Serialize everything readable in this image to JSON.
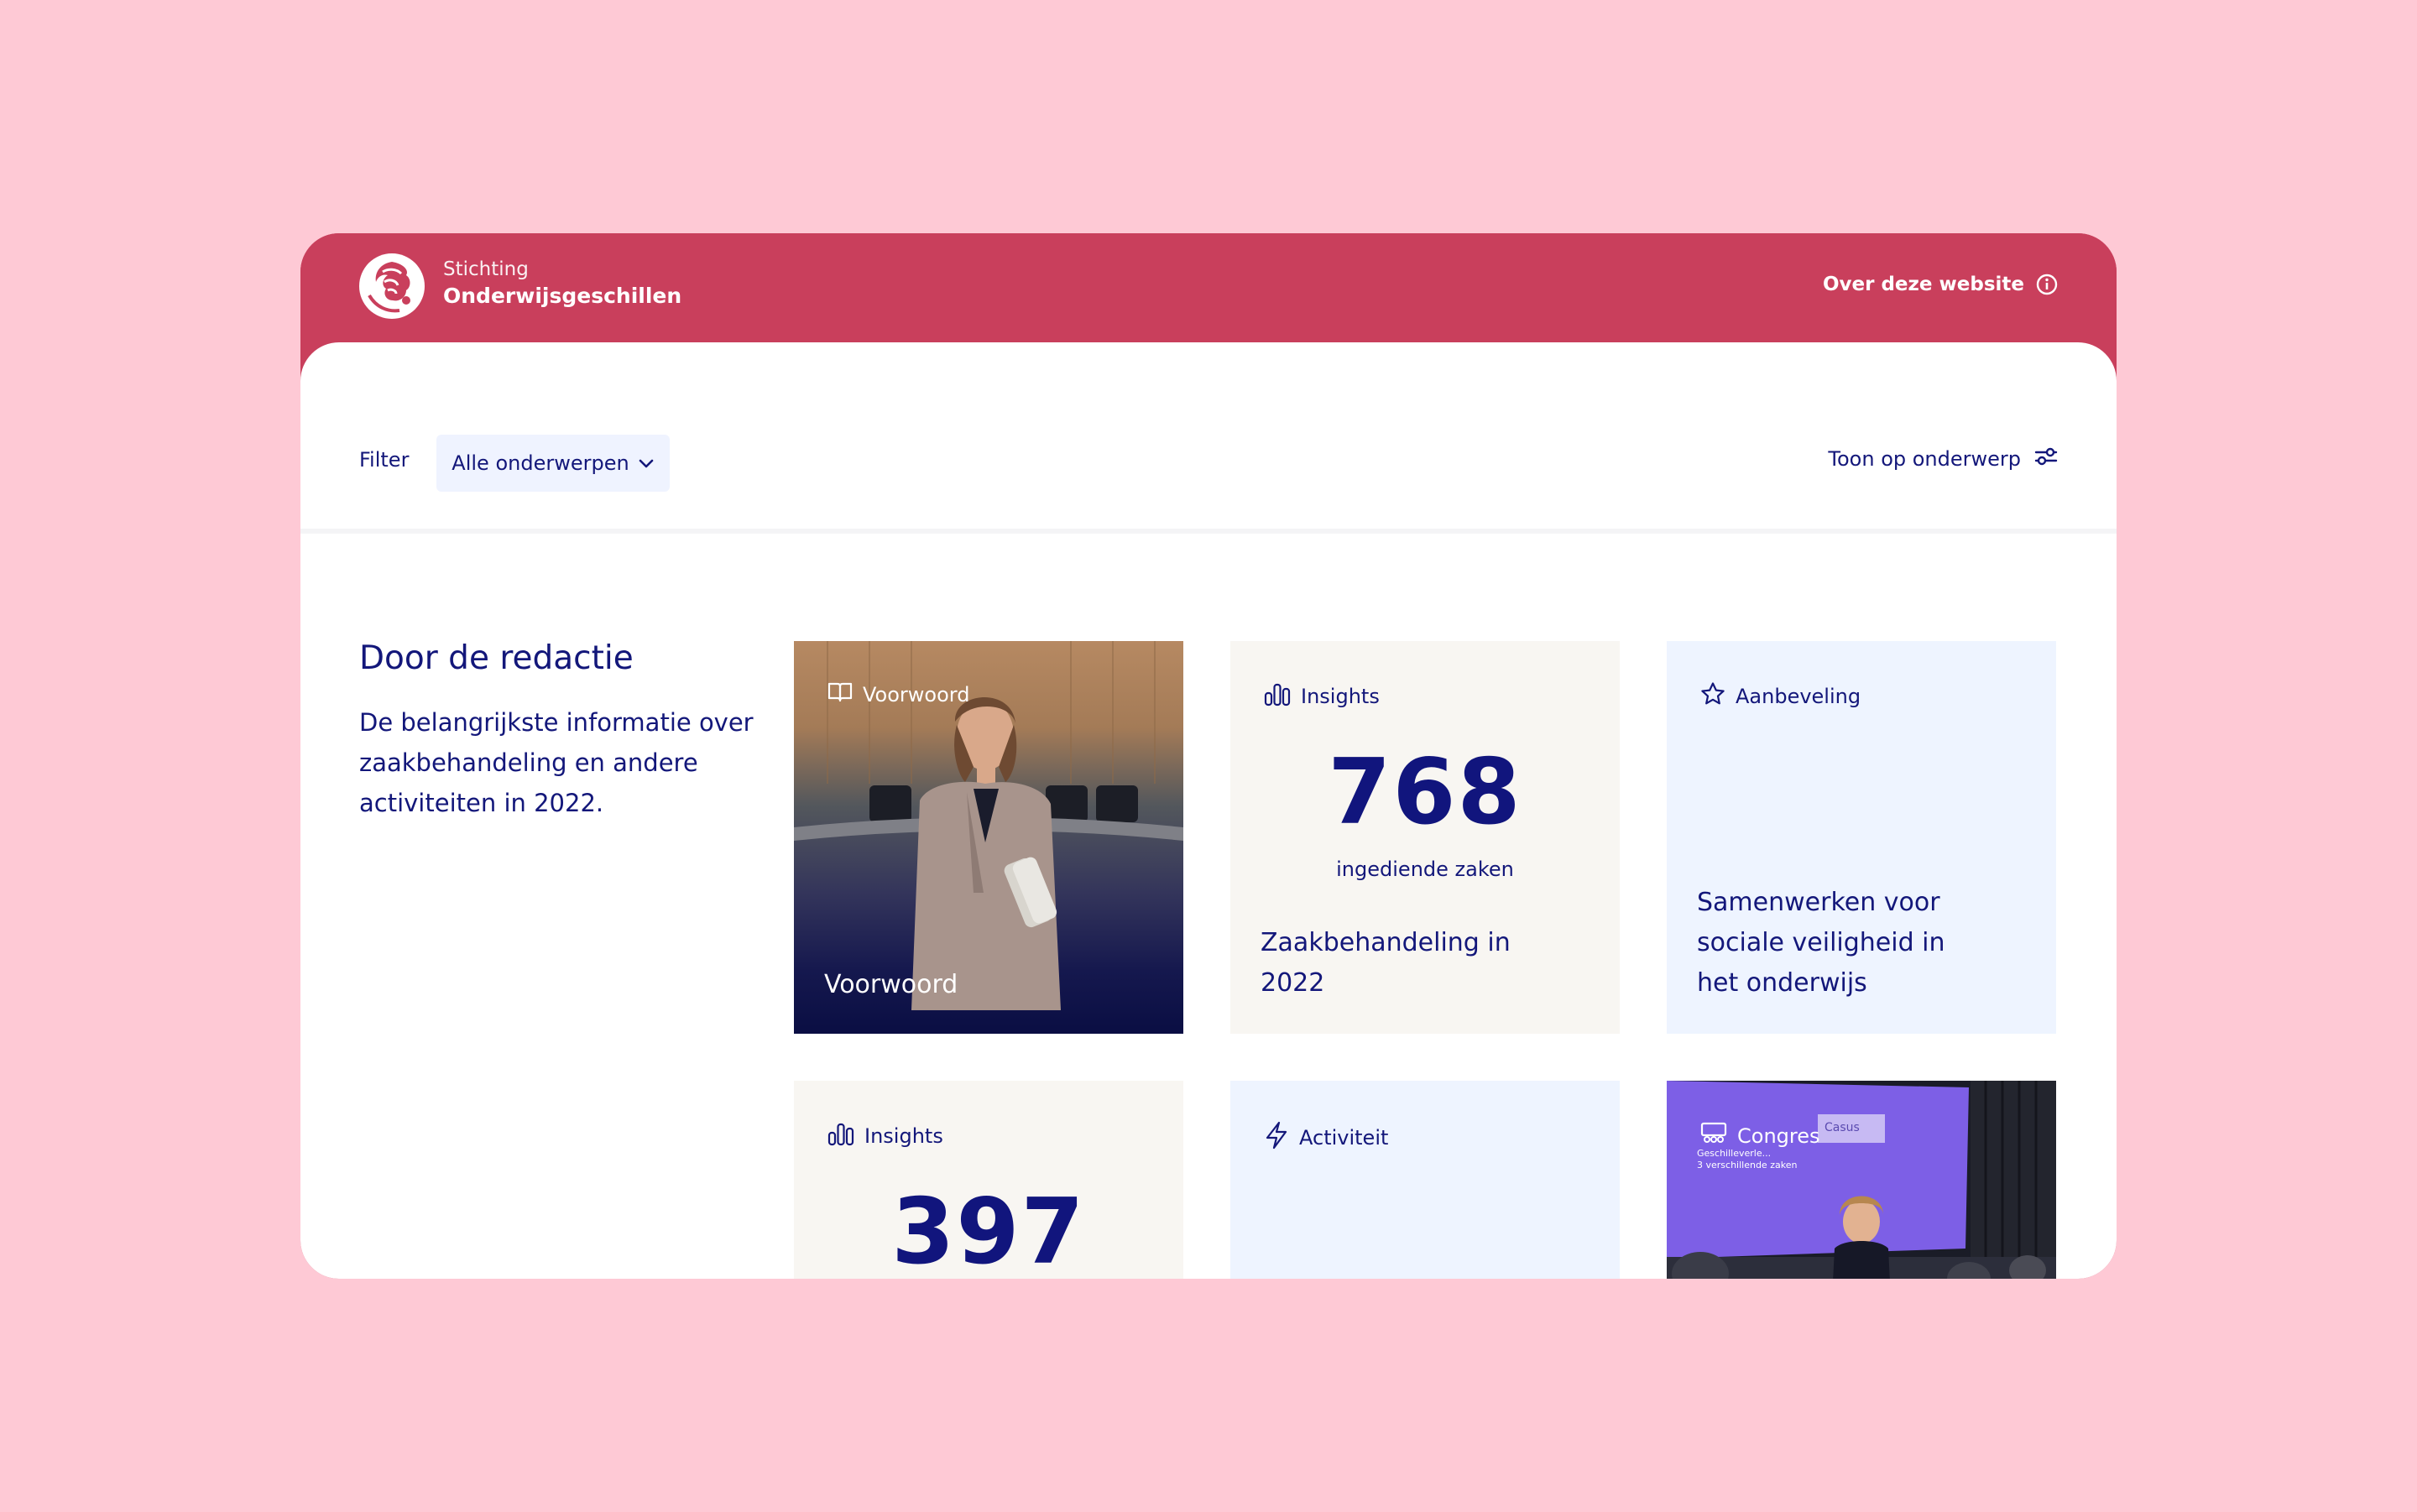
{
  "header": {
    "brand_small": "Stichting",
    "brand_main": "Onderwijsgeschillen",
    "about_label": "Over deze website",
    "logo_icon": "onderwijsgeschillen-logo",
    "info_icon": "info-icon"
  },
  "filter": {
    "label": "Filter",
    "select_value": "Alle onderwerpen",
    "toggle_label": "Toon op onderwerp"
  },
  "intro": {
    "title": "Door de redactie",
    "text": "De belangrijkste informatie over zaakbehandeling en andere activiteiten in 2022."
  },
  "cards": [
    {
      "label": "Voorwoord",
      "title": "Voorwoord",
      "icon": "book-icon",
      "style": "photo"
    },
    {
      "label": "Insights",
      "number": "768",
      "caption": "ingediende zaken",
      "title": "Zaakbehandeling in 2022",
      "icon": "bar-chart-icon",
      "style": "beige"
    },
    {
      "label": "Aanbeveling",
      "title": "Samenwerken voor sociale veiligheid in het onderwijs",
      "icon": "star-icon",
      "style": "blue"
    },
    {
      "label": "Insights",
      "number": "397",
      "icon": "bar-chart-icon",
      "style": "beige"
    },
    {
      "label": "Activiteit",
      "icon": "lightning-icon",
      "style": "blue"
    },
    {
      "label": "Congres",
      "icon": "presentation-icon",
      "style": "photo",
      "slide_title": "Casus",
      "slide_bullets": [
        "Geschilleverle...",
        "3 verschillende zaken"
      ]
    }
  ],
  "colors": {
    "page_background": "#fec9d5",
    "brand_red": "#c93f5c",
    "text_navy": "#13177a",
    "card_beige": "#f8f6f2",
    "card_blue": "#eef4ff"
  }
}
